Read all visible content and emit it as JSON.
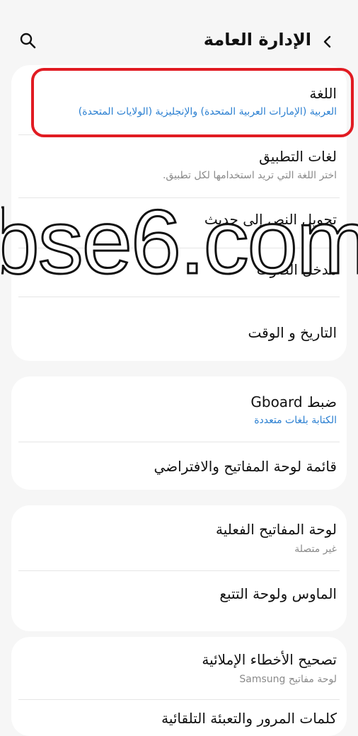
{
  "header": {
    "title": "الإدارة العامة"
  },
  "items": [
    {
      "title": "اللغة",
      "subtitle": "العربية (الإمارات العربية المتحدة) والإنجليزية (الولايات المتحدة)"
    },
    {
      "title": "لغات التطبيق",
      "subtitle": "اختر اللغة التي تريد استخدامها لكل تطبيق."
    },
    {
      "title": "تحويل النص إلى حديث"
    },
    {
      "title": "مدخل الصوت"
    },
    {
      "title": "التاريخ و الوقت"
    },
    {
      "title": "ضبط Gboard",
      "subtitle": "الكتابة بلغات متعددة"
    },
    {
      "title": "قائمة لوحة المفاتيح والافتراضي"
    },
    {
      "title": "لوحة المفاتيح الفعلية",
      "subtitle": "غير متصلة"
    },
    {
      "title": "الماوس ولوحة التتبع"
    },
    {
      "title": "تصحيح الأخطاء الإملائية",
      "subtitle": "لوحة مفاتيح Samsung"
    },
    {
      "title": "كلمات المرور والتعبئة التلقائية"
    }
  ],
  "watermark": {
    "text": "bse6.com"
  },
  "colors": {
    "background": "#f6f6f6",
    "card": "#ffffff",
    "highlight": "#e11b22",
    "link": "#2a7fd1",
    "secondary_text": "#8a8a8a"
  }
}
